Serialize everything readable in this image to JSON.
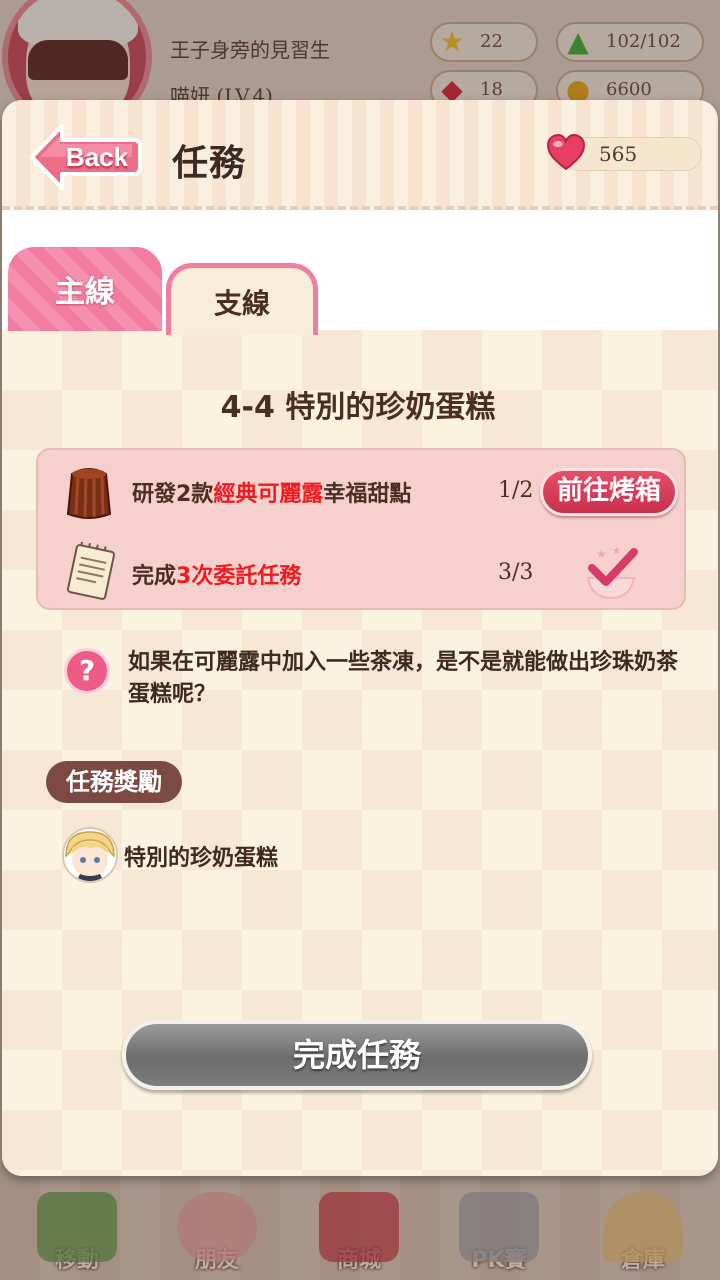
{
  "profile": {
    "title": "王子身旁的見習生",
    "name_level": "喵妍 (LV.4)",
    "stats": {
      "stars": "22",
      "energy": "102/102",
      "gems": "18",
      "coins": "6600"
    }
  },
  "header": {
    "back_label": "Back",
    "title": "任務",
    "hearts": "565"
  },
  "tabs": [
    {
      "label": "主線",
      "active": true
    },
    {
      "label": "支線",
      "active": false
    }
  ],
  "quest": {
    "title": "4-4 特別的珍奶蛋糕",
    "tasks": [
      {
        "text_prefix": "研發2款",
        "text_highlight": "經典可麗露",
        "text_suffix": "幸福甜點",
        "progress": "1/2",
        "action_label": "前往烤箱",
        "icon": "canele-icon"
      },
      {
        "text_prefix": "完成",
        "text_highlight": "3次委託任務",
        "text_suffix": "",
        "progress": "3/3",
        "icon": "notepad-icon",
        "status_icon": "checkmark-icon"
      }
    ],
    "hint": "如果在可麗露中加入一些茶凍，是不是就能做出珍珠奶茶蛋糕呢？",
    "reward_heading": "任務獎勵",
    "reward_item": "特別的珍奶蛋糕",
    "complete_label": "完成任務"
  },
  "nav": [
    {
      "label": "移動"
    },
    {
      "label": "朋友"
    },
    {
      "label": "商城"
    },
    {
      "label": "PK賽"
    },
    {
      "label": "倉庫"
    }
  ],
  "colors": {
    "accent_pink": "#ef7ea0",
    "highlight_red": "#ee1b22",
    "panel_bg": "#fbf2df"
  }
}
